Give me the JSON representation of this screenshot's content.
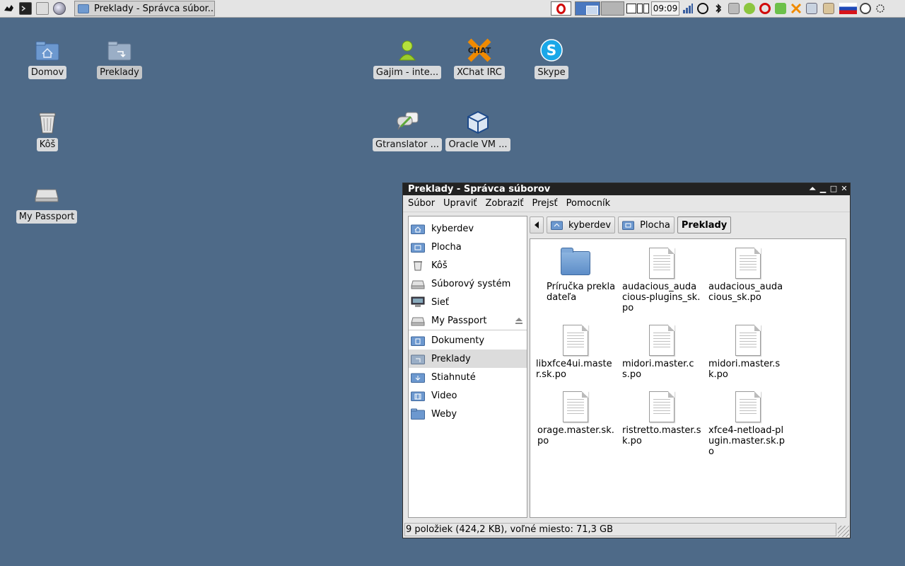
{
  "panel": {
    "task_title": "Preklady - Správca súbor...",
    "clock": "09:09",
    "launchers": [
      "xfce-mouse-icon",
      "terminal-icon",
      "file-manager-icon",
      "web-browser-icon"
    ],
    "tray": [
      "network-icon",
      "avast-icon",
      "bluetooth-icon",
      "mail-icon",
      "gajim-icon",
      "opera-mail-icon",
      "update-ok-icon",
      "xchat-icon",
      "network-manager-icon",
      "clipboard-icon",
      "keyboard-layout-sk-icon",
      "clock-icon",
      "settings-icon"
    ]
  },
  "desktop": {
    "icons": [
      {
        "label": "Domov"
      },
      {
        "label": "Preklady"
      },
      {
        "label": "Kôš"
      },
      {
        "label": "My Passport"
      },
      {
        "label": "Gajim - inte..."
      },
      {
        "label": "XChat IRC"
      },
      {
        "label": "Skype"
      },
      {
        "label": "Gtranslator ..."
      },
      {
        "label": "Oracle VM ..."
      }
    ]
  },
  "window": {
    "title": "Preklady - Správca súborov",
    "menu": [
      "Súbor",
      "Upraviť",
      "Zobraziť",
      "Prejsť",
      "Pomocník"
    ],
    "sidebar": {
      "devices": [
        {
          "label": "kyberdev",
          "icon": "home-folder-icon"
        },
        {
          "label": "Plocha",
          "icon": "desktop-folder-icon"
        },
        {
          "label": "Kôš",
          "icon": "trash-icon"
        },
        {
          "label": "Súborový systém",
          "icon": "drive-icon"
        },
        {
          "label": "Sieť",
          "icon": "network-icon"
        },
        {
          "label": "My Passport",
          "icon": "external-drive-icon"
        }
      ],
      "places": [
        {
          "label": "Dokumenty",
          "icon": "documents-folder-icon"
        },
        {
          "label": "Preklady",
          "icon": "folder-link-icon",
          "selected": true
        },
        {
          "label": "Stiahnuté",
          "icon": "downloads-folder-icon"
        },
        {
          "label": "Video",
          "icon": "video-folder-icon"
        },
        {
          "label": "Weby",
          "icon": "folder-icon"
        }
      ]
    },
    "path": [
      "kyberdev",
      "Plocha",
      "Preklady"
    ],
    "files": [
      {
        "name": "Príručka prekladateľa",
        "type": "folder"
      },
      {
        "name": "audacious_audacious-plugins_sk.po",
        "type": "file"
      },
      {
        "name": "audacious_audacious_sk.po",
        "type": "file"
      },
      {
        "name": "libxfce4ui.master.sk.po",
        "type": "file"
      },
      {
        "name": "midori.master.cs.po",
        "type": "file"
      },
      {
        "name": "midori.master.sk.po",
        "type": "file"
      },
      {
        "name": "orage.master.sk.po",
        "type": "file"
      },
      {
        "name": "ristretto.master.sk.po",
        "type": "file"
      },
      {
        "name": "xfce4-netload-plugin.master.sk.po",
        "type": "file"
      }
    ],
    "status": "9 položiek (424,2 KB), voľné miesto: 71,3 GB"
  }
}
